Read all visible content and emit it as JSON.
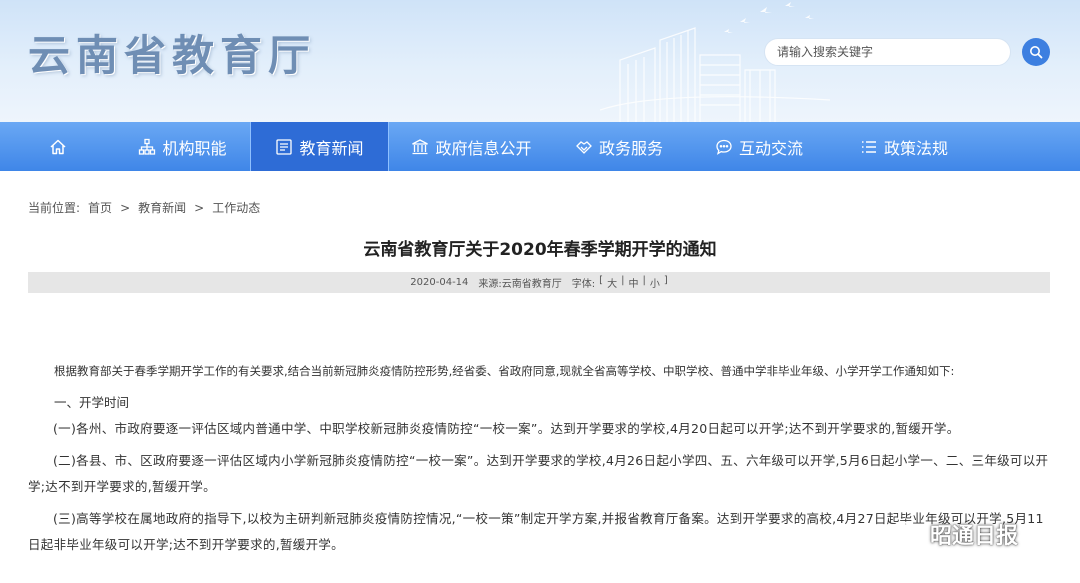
{
  "header": {
    "site_title": "云南省教育厅",
    "search_placeholder": "请输入搜索关键字"
  },
  "nav": {
    "items": [
      {
        "label": "",
        "icon": "home-icon"
      },
      {
        "label": "机构职能",
        "icon": "org-chart-icon"
      },
      {
        "label": "教育新闻",
        "icon": "newspaper-icon",
        "active": true
      },
      {
        "label": "政府信息公开",
        "icon": "government-building-icon"
      },
      {
        "label": "政务服务",
        "icon": "handshake-icon"
      },
      {
        "label": "互动交流",
        "icon": "chat-bubble-icon"
      },
      {
        "label": "政策法规",
        "icon": "list-icon"
      }
    ]
  },
  "breadcrumb": {
    "prefix": "当前位置:",
    "items": [
      "首页",
      "教育新闻",
      "工作动态"
    ],
    "separator": ">"
  },
  "article": {
    "title": "云南省教育厅关于2020年春季学期开学的通知",
    "date": "2020-04-14",
    "source": "来源:云南省教育厅",
    "font_size_label": "字体:",
    "font_sizes": [
      "大",
      "中",
      "小"
    ],
    "intro": "根据教育部关于春季学期开学工作的有关要求,结合当前新冠肺炎疫情防控形势,经省委、省政府同意,现就全省高等学校、中职学校、普通中学非毕业年级、小学开学工作通知如下:",
    "section1_heading": "一、开学时间",
    "para1": "(一)各州、市政府要逐一评估区域内普通中学、中职学校新冠肺炎疫情防控“一校一案”。达到开学要求的学校,4月20日起可以开学;达不到开学要求的,暂缓开学。",
    "para2": "(二)各县、市、区政府要逐一评估区域内小学新冠肺炎疫情防控“一校一案”。达到开学要求的学校,4月26日起小学四、五、六年级可以开学,5月6日起小学一、二、三年级可以开学;达不到开学要求的,暂缓开学。",
    "para3": "(三)高等学校在属地政府的指导下,以校为主研判新冠肺炎疫情防控情况,“一校一策”制定开学方案,并报省教育厅备案。达到开学要求的高校,4月27日起毕业年级可以开学,5月11日起非毕业年级可以开学;达不到开学要求的,暂缓开学。"
  },
  "watermark": {
    "text": "昭通日报",
    "icon": "wechat-icon"
  },
  "colors": {
    "nav_bg": "#4a90ee",
    "nav_active": "#2e6cd6",
    "search_btn": "#3d7fe0",
    "title_color": "#6f8eb4"
  }
}
